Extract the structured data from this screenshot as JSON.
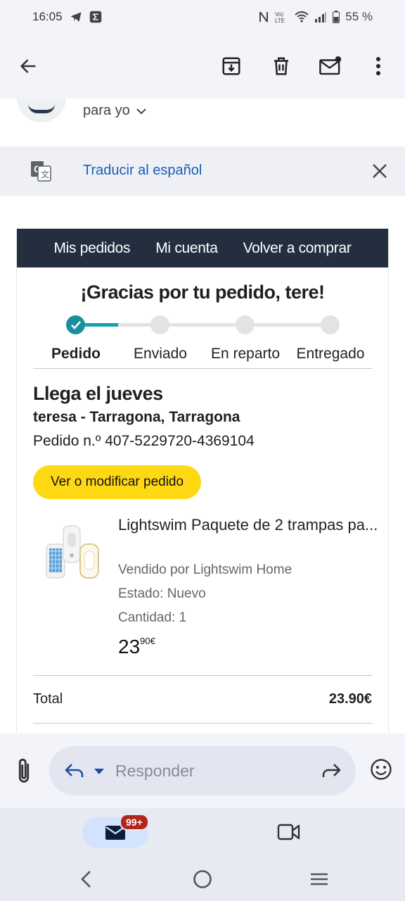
{
  "status_bar": {
    "time": "16:05",
    "battery": "55 %"
  },
  "toolbar": {
    "back_icon": "arrow-left-icon",
    "icons": [
      "archive-icon",
      "delete-icon",
      "mark-unread-icon",
      "more-vert-icon"
    ]
  },
  "header": {
    "to_label": "para yo"
  },
  "translate": {
    "link": "Traducir al español"
  },
  "email": {
    "nav": [
      "Mis pedidos",
      "Mi cuenta",
      "Volver a comprar"
    ],
    "thanks": "¡Gracias por tu pedido, tere!",
    "progress": {
      "steps": [
        "Pedido",
        "Enviado",
        "En reparto",
        "Entregado"
      ],
      "current_step": 1
    },
    "arrival": "Llega el jueves",
    "address": "teresa - Tarragona, Tarragona",
    "order_number": "Pedido n.º 407-5229720-4369104",
    "modify_button": "Ver o modificar pedido",
    "item": {
      "title": "Lightswim Paquete de 2 trampas pa...",
      "seller": "Vendido por Lightswim Home",
      "status": "Estado: Nuevo",
      "quantity": "Cantidad: 1",
      "price_main": "23",
      "price_cents": "90€"
    },
    "total_label": "Total",
    "total_value": "23.90€"
  },
  "reply": {
    "placeholder": "Responder"
  },
  "bottom_nav": {
    "mail_badge": "99+"
  }
}
